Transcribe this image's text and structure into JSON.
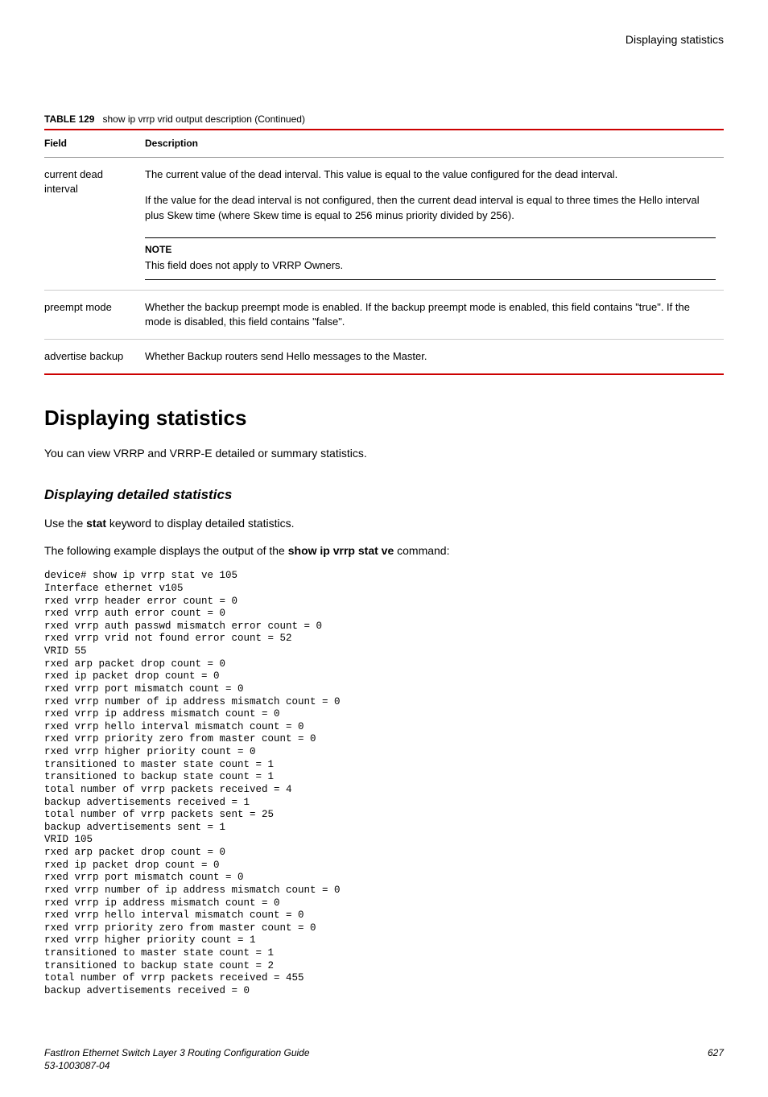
{
  "header": {
    "title": "Displaying statistics"
  },
  "table": {
    "label_prefix": "TABLE 129",
    "label_text": "show ip vrrp vrid output description (Continued)",
    "head_field": "Field",
    "head_desc": "Description",
    "rows": [
      {
        "field": "current dead interval",
        "desc_p1": "The current value of the dead interval. This value is equal to the value configured for the dead interval.",
        "desc_p2": "If the value for the dead interval is not configured, then the current dead interval is equal to three times the Hello interval plus Skew time (where Skew time is equal to 256 minus priority divided by 256).",
        "note_label": "NOTE",
        "note_text": "This field does not apply to VRRP Owners."
      },
      {
        "field": "preempt mode",
        "desc": "Whether the backup preempt mode is enabled. If the backup preempt mode is enabled, this field contains \"true\". If the mode is disabled, this field contains \"false\"."
      },
      {
        "field": "advertise backup",
        "desc": "Whether Backup routers send Hello messages to the Master."
      }
    ]
  },
  "section": {
    "h1": "Displaying statistics",
    "intro": "You can view VRRP and VRRP-E detailed or summary statistics.",
    "h2": "Displaying detailed statistics",
    "p2_pre": "Use the ",
    "p2_bold": "stat",
    "p2_post": " keyword to display detailed statistics.",
    "p3_pre": "The following example displays the output of the ",
    "p3_bold": "show ip vrrp stat ve",
    "p3_post": " command:",
    "code": "device# show ip vrrp stat ve 105\nInterface ethernet v105\nrxed vrrp header error count = 0\nrxed vrrp auth error count = 0\nrxed vrrp auth passwd mismatch error count = 0\nrxed vrrp vrid not found error count = 52\nVRID 55\nrxed arp packet drop count = 0\nrxed ip packet drop count = 0\nrxed vrrp port mismatch count = 0\nrxed vrrp number of ip address mismatch count = 0\nrxed vrrp ip address mismatch count = 0\nrxed vrrp hello interval mismatch count = 0\nrxed vrrp priority zero from master count = 0\nrxed vrrp higher priority count = 0\ntransitioned to master state count = 1\ntransitioned to backup state count = 1\ntotal number of vrrp packets received = 4\nbackup advertisements received = 1\ntotal number of vrrp packets sent = 25\nbackup advertisements sent = 1\nVRID 105\nrxed arp packet drop count = 0\nrxed ip packet drop count = 0\nrxed vrrp port mismatch count = 0\nrxed vrrp number of ip address mismatch count = 0\nrxed vrrp ip address mismatch count = 0\nrxed vrrp hello interval mismatch count = 0\nrxed vrrp priority zero from master count = 0\nrxed vrrp higher priority count = 1\ntransitioned to master state count = 1\ntransitioned to backup state count = 2\ntotal number of vrrp packets received = 455\nbackup advertisements received = 0"
  },
  "footer": {
    "left_line1": "FastIron Ethernet Switch Layer 3 Routing Configuration Guide",
    "left_line2": "53-1003087-04",
    "right": "627"
  }
}
